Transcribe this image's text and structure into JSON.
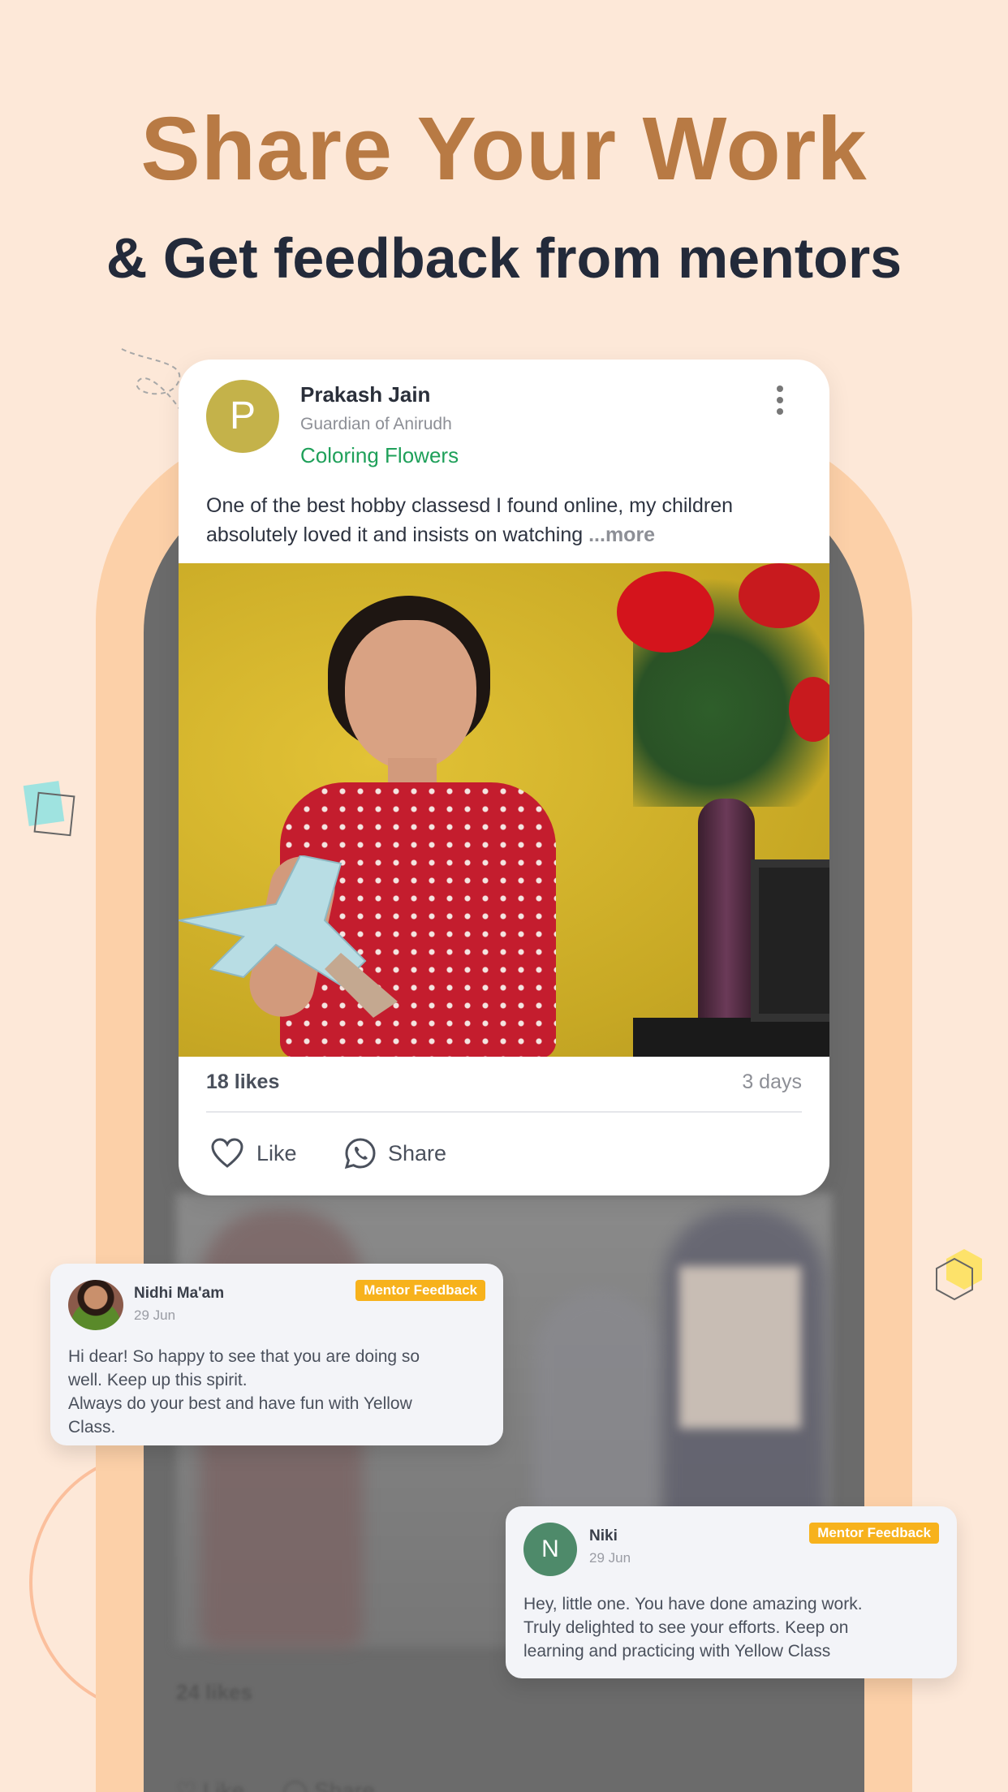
{
  "header": {
    "title": "Share Your Work",
    "subtitle": "& Get feedback from mentors"
  },
  "post": {
    "avatar_letter": "P",
    "author": "Prakash Jain",
    "relation": "Guardian of Anirudh",
    "topic": "Coloring Flowers",
    "text": "One of the best hobby classesd I found online, my children absolutely loved it and insists on watching ",
    "more_label": "...more",
    "likes": "18 likes",
    "time": "3 days",
    "like_label": "Like",
    "share_label": "Share"
  },
  "background_post": {
    "likes": "24 likes",
    "like_label": "Like",
    "share_label": "Share"
  },
  "feedback": [
    {
      "name": "Nidhi Ma'am",
      "date": "29 Jun",
      "badge": "Mentor Feedback",
      "text": "Hi dear! So happy to see that you are doing so\nwell. Keep up this spirit.\n Always do your best and have fun with Yellow\nClass."
    },
    {
      "avatar_letter": "N",
      "name": "Niki",
      "date": "29 Jun",
      "badge": "Mentor Feedback",
      "text": "Hey, little one. You have done amazing work.\nTruly delighted to see your efforts.  Keep on\nlearning and practicing with Yellow Class"
    }
  ],
  "colors": {
    "background": "#fde8d8",
    "title": "#b87a44",
    "subtitle": "#232a3a",
    "topic": "#1fa05a",
    "badge": "#f7b21c",
    "phone_frame": "#fcd0a8"
  },
  "icons": [
    "more-vertical-icon",
    "heart-icon",
    "whatsapp-icon"
  ]
}
